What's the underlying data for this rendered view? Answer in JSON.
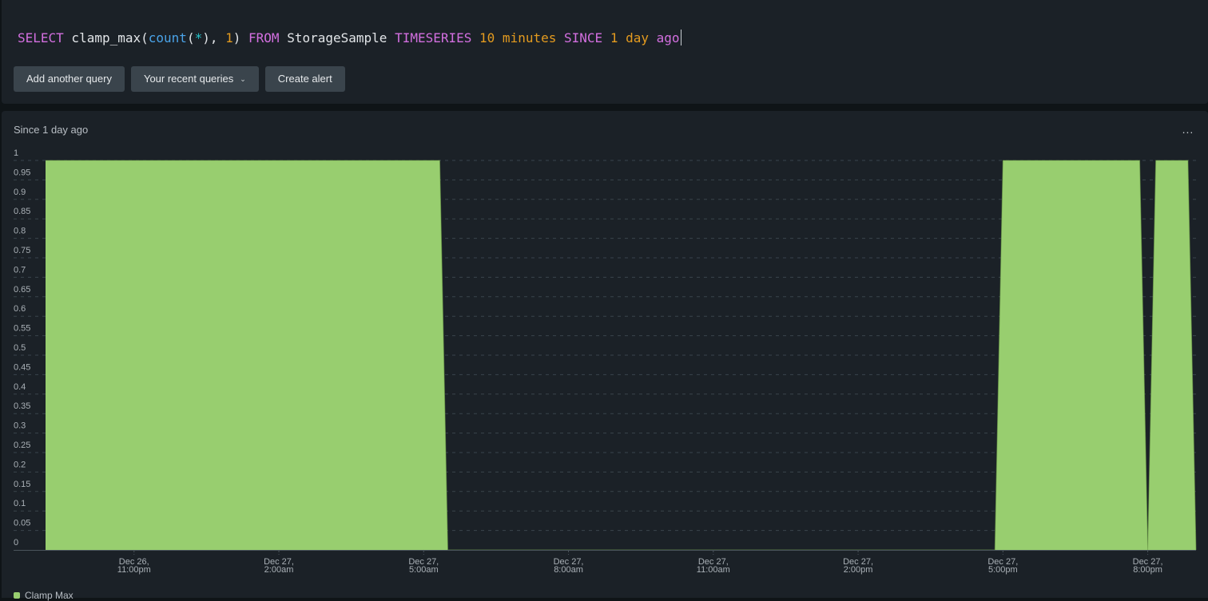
{
  "query": {
    "tokens": [
      {
        "text": "SELECT",
        "type": "kw"
      },
      {
        "text": " clamp_max(",
        "type": "plain"
      },
      {
        "text": "count",
        "type": "fn"
      },
      {
        "text": "(",
        "type": "plain"
      },
      {
        "text": "*",
        "type": "star"
      },
      {
        "text": "), ",
        "type": "plain"
      },
      {
        "text": "1",
        "type": "num"
      },
      {
        "text": ") ",
        "type": "plain"
      },
      {
        "text": "FROM",
        "type": "kw"
      },
      {
        "text": " StorageSample ",
        "type": "plain"
      },
      {
        "text": "TIMESERIES",
        "type": "kw"
      },
      {
        "text": " ",
        "type": "plain"
      },
      {
        "text": "10 minutes",
        "type": "num"
      },
      {
        "text": " ",
        "type": "plain"
      },
      {
        "text": "SINCE",
        "type": "kw"
      },
      {
        "text": " ",
        "type": "plain"
      },
      {
        "text": "1 day",
        "type": "num"
      },
      {
        "text": " ",
        "type": "plain"
      },
      {
        "text": "ago",
        "type": "kw"
      }
    ]
  },
  "toolbar": {
    "add_query_label": "Add another query",
    "recent_queries_label": "Your recent queries",
    "create_alert_label": "Create alert"
  },
  "panel": {
    "title": "Since 1 day ago",
    "more_label": "..."
  },
  "colors": {
    "series": "#98ce6f",
    "grid": "#3a444c",
    "axis": "#4a545c"
  },
  "chart_data": {
    "type": "area",
    "title": "Since 1 day ago",
    "xlabel": "",
    "ylabel": "",
    "ylim": [
      0,
      1
    ],
    "yticks": [
      "1",
      "0.95",
      "0.9",
      "0.85",
      "0.8",
      "0.75",
      "0.7",
      "0.65",
      "0.6",
      "0.55",
      "0.5",
      "0.45",
      "0.4",
      "0.35",
      "0.3",
      "0.25",
      "0.2",
      "0.15",
      "0.1",
      "0.05",
      "0"
    ],
    "grid": true,
    "bucket_minutes": 10,
    "start": "Dec 26, 9:10pm",
    "end": "Dec 27, 9:00pm",
    "xticks": [
      {
        "line1": "Dec 26,",
        "line2": "11:00pm",
        "index": 11
      },
      {
        "line1": "Dec 27,",
        "line2": "2:00am",
        "index": 29
      },
      {
        "line1": "Dec 27,",
        "line2": "5:00am",
        "index": 47
      },
      {
        "line1": "Dec 27,",
        "line2": "8:00am",
        "index": 65
      },
      {
        "line1": "Dec 27,",
        "line2": "11:00am",
        "index": 83
      },
      {
        "line1": "Dec 27,",
        "line2": "2:00pm",
        "index": 101
      },
      {
        "line1": "Dec 27,",
        "line2": "5:00pm",
        "index": 119
      },
      {
        "line1": "Dec 27,",
        "line2": "8:00pm",
        "index": 137
      }
    ],
    "series": [
      {
        "name": "Clamp Max",
        "segments": [
          {
            "from_index": 0,
            "to_index": 49,
            "value": 1
          },
          {
            "from_index": 50,
            "to_index": 118,
            "value": 0
          },
          {
            "from_index": 119,
            "to_index": 136,
            "value": 1
          },
          {
            "from_index": 137,
            "to_index": 137,
            "value": 0
          },
          {
            "from_index": 138,
            "to_index": 142,
            "value": 1
          },
          {
            "from_index": 143,
            "to_index": 143,
            "value": 0
          }
        ]
      }
    ]
  }
}
